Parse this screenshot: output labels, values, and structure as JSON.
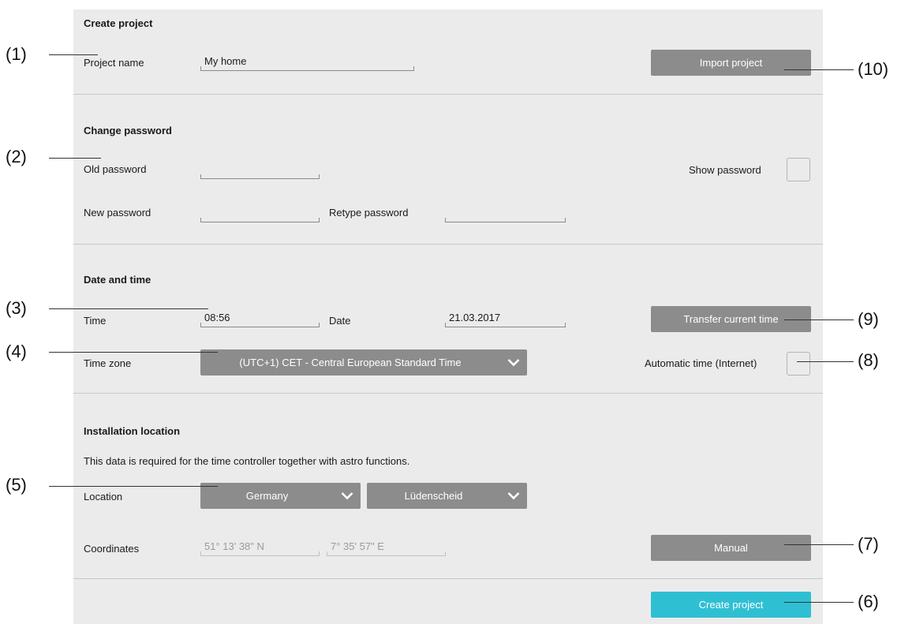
{
  "create_project": {
    "heading": "Create project",
    "project_name_label": "Project name",
    "project_name_value": "My home",
    "import_button": "Import project"
  },
  "change_password": {
    "heading": "Change password",
    "old_password_label": "Old password",
    "new_password_label": "New password",
    "retype_password_label": "Retype password",
    "show_password_label": "Show password"
  },
  "date_time": {
    "heading": "Date and time",
    "time_label": "Time",
    "time_value": "08:56",
    "date_label": "Date",
    "date_value": "21.03.2017",
    "transfer_button": "Transfer current time",
    "timezone_label": "Time zone",
    "timezone_value": "(UTC+1) CET - Central European Standard Time",
    "auto_time_label": "Automatic time (Internet)"
  },
  "installation": {
    "heading": "Installation location",
    "description": "This data is required for the time controller together with astro functions.",
    "location_label": "Location",
    "country_value": "Germany",
    "city_value": "Lüdenscheid",
    "coordinates_label": "Coordinates",
    "latitude_value": "51° 13' 38\" N",
    "longitude_value": "7° 35' 57\" E",
    "manual_button": "Manual"
  },
  "footer": {
    "create_button": "Create project"
  },
  "callouts": [
    "(1)",
    "(2)",
    "(3)",
    "(4)",
    "(5)",
    "(6)",
    "(7)",
    "(8)",
    "(9)",
    "(10)"
  ],
  "colors": {
    "panel": "#ebebeb",
    "button": "#8c8c8c",
    "primary": "#2fbfd3"
  }
}
